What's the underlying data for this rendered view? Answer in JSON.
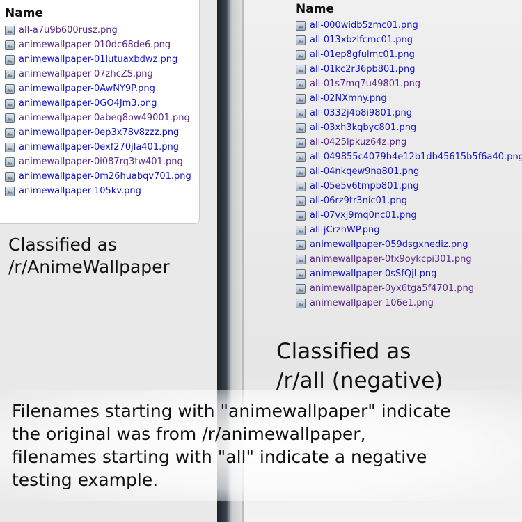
{
  "left_panel": {
    "header": "Name",
    "files": [
      {
        "name": "all-a7u9b600rusz.png",
        "visited": true
      },
      {
        "name": "animewallpaper-010dc68de6.png",
        "visited": true
      },
      {
        "name": "animewallpaper-01lutuaxbdwz.png",
        "visited": false
      },
      {
        "name": "animewallpaper-07zhcZS.png",
        "visited": true
      },
      {
        "name": "animewallpaper-0AwNY9P.png",
        "visited": false
      },
      {
        "name": "animewallpaper-0GO4Jm3.png",
        "visited": false
      },
      {
        "name": "animewallpaper-0abeg8ow49001.png",
        "visited": true
      },
      {
        "name": "animewallpaper-0ep3x78v8zzz.png",
        "visited": false
      },
      {
        "name": "animewallpaper-0exf270jla401.png",
        "visited": false
      },
      {
        "name": "animewallpaper-0i087rg3tw401.png",
        "visited": true
      },
      {
        "name": "animewallpaper-0m26huabqv701.png",
        "visited": false
      },
      {
        "name": "animewallpaper-105kv.png",
        "visited": false
      }
    ],
    "caption_line1": "Classified as",
    "caption_line2": "/r/AnimeWallpaper"
  },
  "right_panel": {
    "header": "Name",
    "files": [
      {
        "name": "all-000widb5zmc01.png",
        "visited": false
      },
      {
        "name": "all-013xbzlfcmc01.png",
        "visited": false
      },
      {
        "name": "all-01ep8gfulmc01.png",
        "visited": false
      },
      {
        "name": "all-01kc2r36pb801.png",
        "visited": false
      },
      {
        "name": "all-01s7mq7u49801.png",
        "visited": true
      },
      {
        "name": "all-02NXmny.png",
        "visited": false
      },
      {
        "name": "all-0332j4b8i9801.png",
        "visited": false
      },
      {
        "name": "all-03xh3kqbyc801.png",
        "visited": false
      },
      {
        "name": "all-0425lpkuz64z.png",
        "visited": true
      },
      {
        "name": "all-049855c4079b4e12b1db45615b5f6a40.png",
        "visited": false
      },
      {
        "name": "all-04nkqew9na801.png",
        "visited": false
      },
      {
        "name": "all-05e5v6tmpb801.png",
        "visited": false
      },
      {
        "name": "all-06rz9tr3nic01.png",
        "visited": false
      },
      {
        "name": "all-07vxj9mq0nc01.png",
        "visited": false
      },
      {
        "name": "all-jCrzhWP.png",
        "visited": false
      },
      {
        "name": "animewallpaper-059dsgxnediz.png",
        "visited": false
      },
      {
        "name": "animewallpaper-0fx9oykcpi301.png",
        "visited": true
      },
      {
        "name": "animewallpaper-0sSfQjI.png",
        "visited": false
      },
      {
        "name": "animewallpaper-0yx6tga5f4701.png",
        "visited": true
      },
      {
        "name": "animewallpaper-106e1.png",
        "visited": true
      }
    ],
    "caption_line1": "Classified as",
    "caption_line2": "/r/all (negative)"
  },
  "footer": {
    "line1": "Filenames starting with \"animewallpaper\" indicate",
    "line2": "the original was from /r/animewallpaper,",
    "line3": "filenames starting with \"all\" indicate a negative",
    "line4": "testing example."
  },
  "colors": {
    "link": "#1414c8",
    "visited": "#5a2a8a"
  },
  "icons": {
    "file_icon": "image-file-icon"
  }
}
